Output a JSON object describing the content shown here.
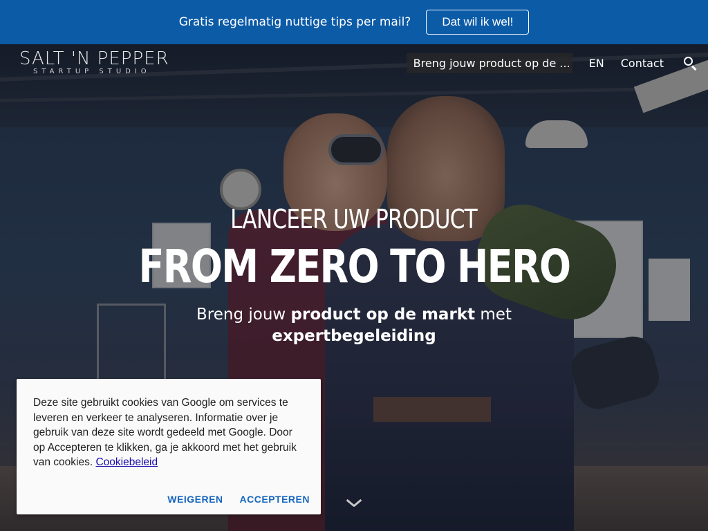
{
  "topbar": {
    "message": "Gratis regelmatig nuttige tips per mail?",
    "cta_label": "Dat wil ik wel!"
  },
  "header": {
    "logo_main": "SALT 'N PEPPER",
    "logo_sub": "STARTUP STUDIO",
    "nav": {
      "highlight_label": "Breng jouw product op de ...",
      "language_label": "EN",
      "contact_label": "Contact",
      "search_icon": "search-icon"
    }
  },
  "hero": {
    "kicker": "LANCEER UW PRODUCT",
    "headline": "FROM ZERO TO HERO",
    "sub_prefix": "Breng jouw ",
    "sub_bold1": "product op de markt",
    "sub_mid": " met",
    "sub_bold2": "expertbegeleiding",
    "scroll_icon": "chevron-down-icon"
  },
  "cookie": {
    "text": "Deze site gebruikt cookies van Google om services te leveren en verkeer te analyseren. Informatie over je gebruik van deze site wordt gedeeld met Google. Door op Accepteren te klikken, ga je akkoord met het gebruik van cookies. ",
    "policy_link": "Cookiebeleid",
    "decline_label": "WEIGEREN",
    "accept_label": "ACCEPTEREN"
  },
  "colors": {
    "topbar_bg": "#0b5ba7",
    "cookie_button": "#1565c0",
    "link": "#1a0dab"
  }
}
